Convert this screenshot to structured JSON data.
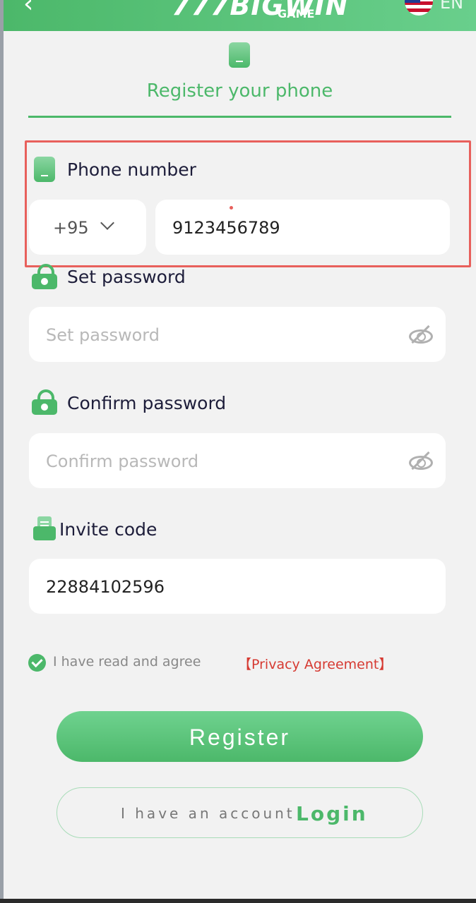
{
  "header": {
    "back_icon": "chevron-left-icon",
    "logo_text": "777BIGWIN",
    "logo_sub": "GAME",
    "flag_icon": "us-flag-icon",
    "language": "EN"
  },
  "page": {
    "title": "Register your phone",
    "title_icon": "phone-icon"
  },
  "phone": {
    "label": "Phone number",
    "country_code": "+95",
    "value": "9123456789"
  },
  "password": {
    "label": "Set password",
    "placeholder": "Set password"
  },
  "confirm": {
    "label": "Confirm password",
    "placeholder": "Confirm password"
  },
  "invite": {
    "label": "Invite code",
    "value": "22884102596"
  },
  "agreement": {
    "text": "I have read and agree",
    "link": "【Privacy Agreement】",
    "checked": true
  },
  "actions": {
    "register": "Register",
    "have_account": "I have an account",
    "login": "Login"
  },
  "colors": {
    "brand_green": "#4cb86a",
    "highlight_red": "#e8605c",
    "link_red": "#d63a32"
  }
}
